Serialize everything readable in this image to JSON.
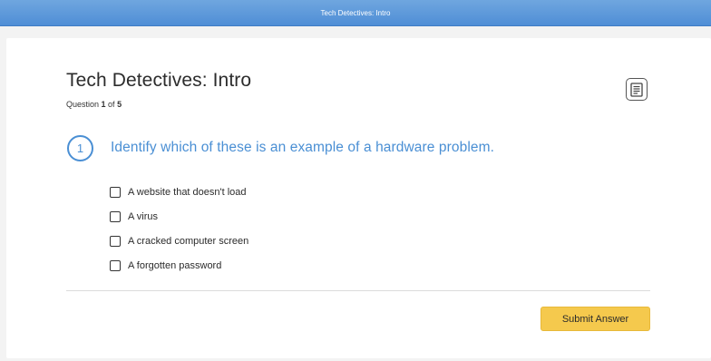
{
  "window": {
    "title": "Tech Detectives: Intro"
  },
  "quiz": {
    "title": "Tech Detectives: Intro",
    "progress_prefix": "Question ",
    "current_question": "1",
    "progress_of": " of ",
    "total_questions": "5"
  },
  "toolbar": {
    "notes_icon": "notes-icon"
  },
  "question": {
    "number": "1",
    "text": "Identify which of these is an example of a hardware problem.",
    "answers": [
      {
        "label": "A website that doesn't load",
        "checked": false
      },
      {
        "label": "A virus",
        "checked": false
      },
      {
        "label": "A cracked computer screen",
        "checked": false
      },
      {
        "label": "A forgotten password",
        "checked": false
      }
    ]
  },
  "actions": {
    "submit_label": "Submit Answer"
  },
  "colors": {
    "accent": "#4a8fd4",
    "topbar": "#5b97da",
    "submit": "#f5c94d"
  }
}
